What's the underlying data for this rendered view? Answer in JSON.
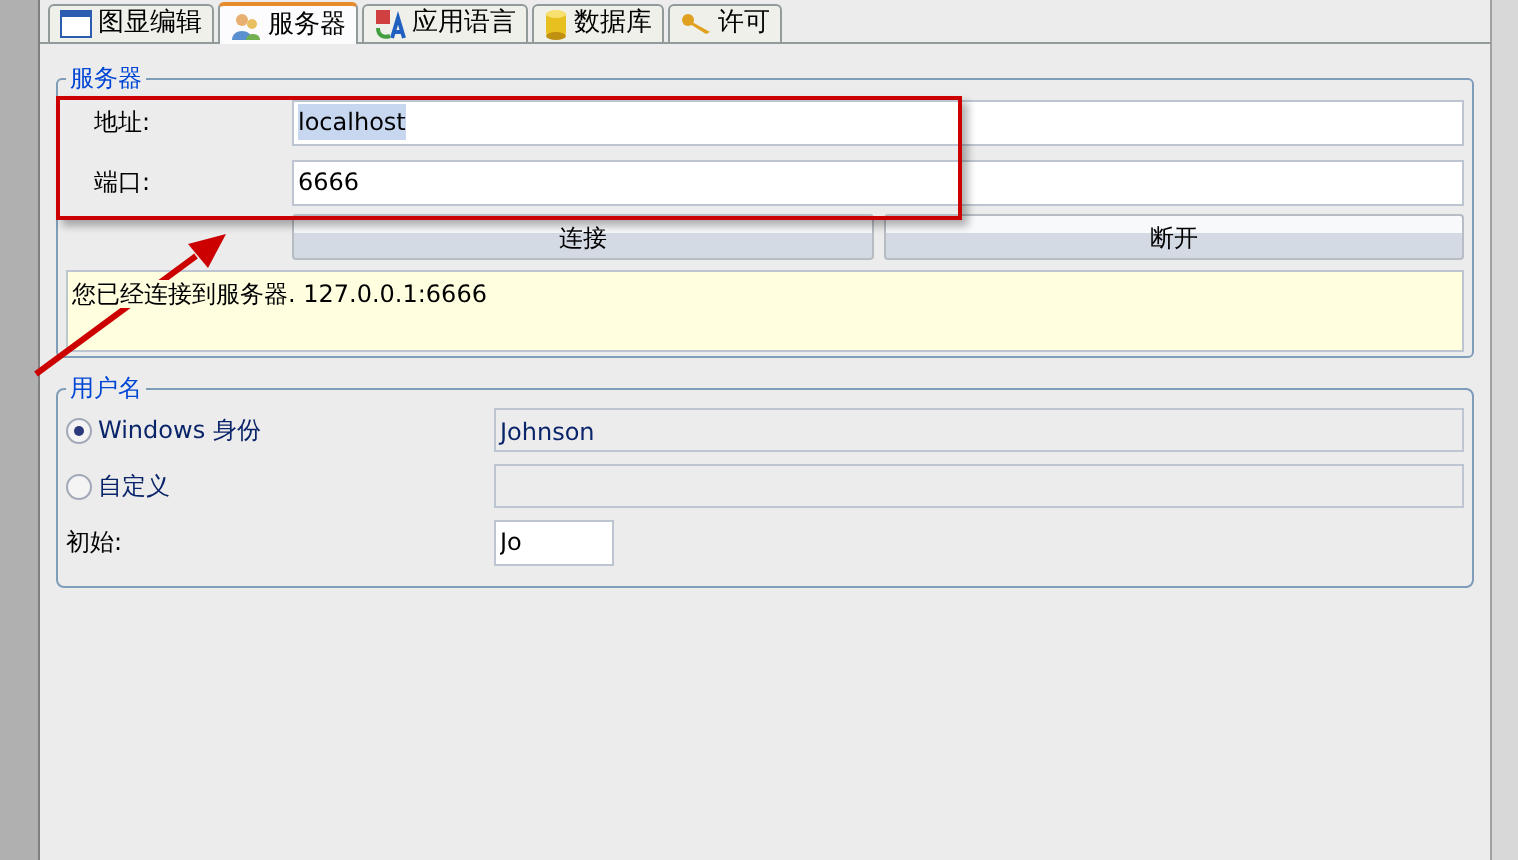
{
  "tabs": [
    {
      "label": "图显编辑",
      "kind": "window",
      "selected": false
    },
    {
      "label": "服务器",
      "kind": "users",
      "selected": true
    },
    {
      "label": "应用语言",
      "kind": "language",
      "selected": false
    },
    {
      "label": "数据库",
      "kind": "database",
      "selected": false
    },
    {
      "label": "许可",
      "kind": "key",
      "selected": false
    }
  ],
  "server": {
    "title": "服务器",
    "fields": [
      {
        "label": "地址:",
        "value": "localhost",
        "highlighted": true
      },
      {
        "label": "端口:",
        "value": "6666",
        "highlighted": false
      }
    ],
    "buttons": [
      "连接",
      "断开"
    ],
    "message": "您已经连接到服务器. 127.0.0.1:6666"
  },
  "user": {
    "title": "用户名",
    "options": [
      {
        "label": "Windows 身份",
        "selected": true,
        "value": "Johnson"
      },
      {
        "label": "自定义",
        "selected": false
      }
    ],
    "initial": {
      "label": "初始:",
      "value": "Jo"
    }
  }
}
